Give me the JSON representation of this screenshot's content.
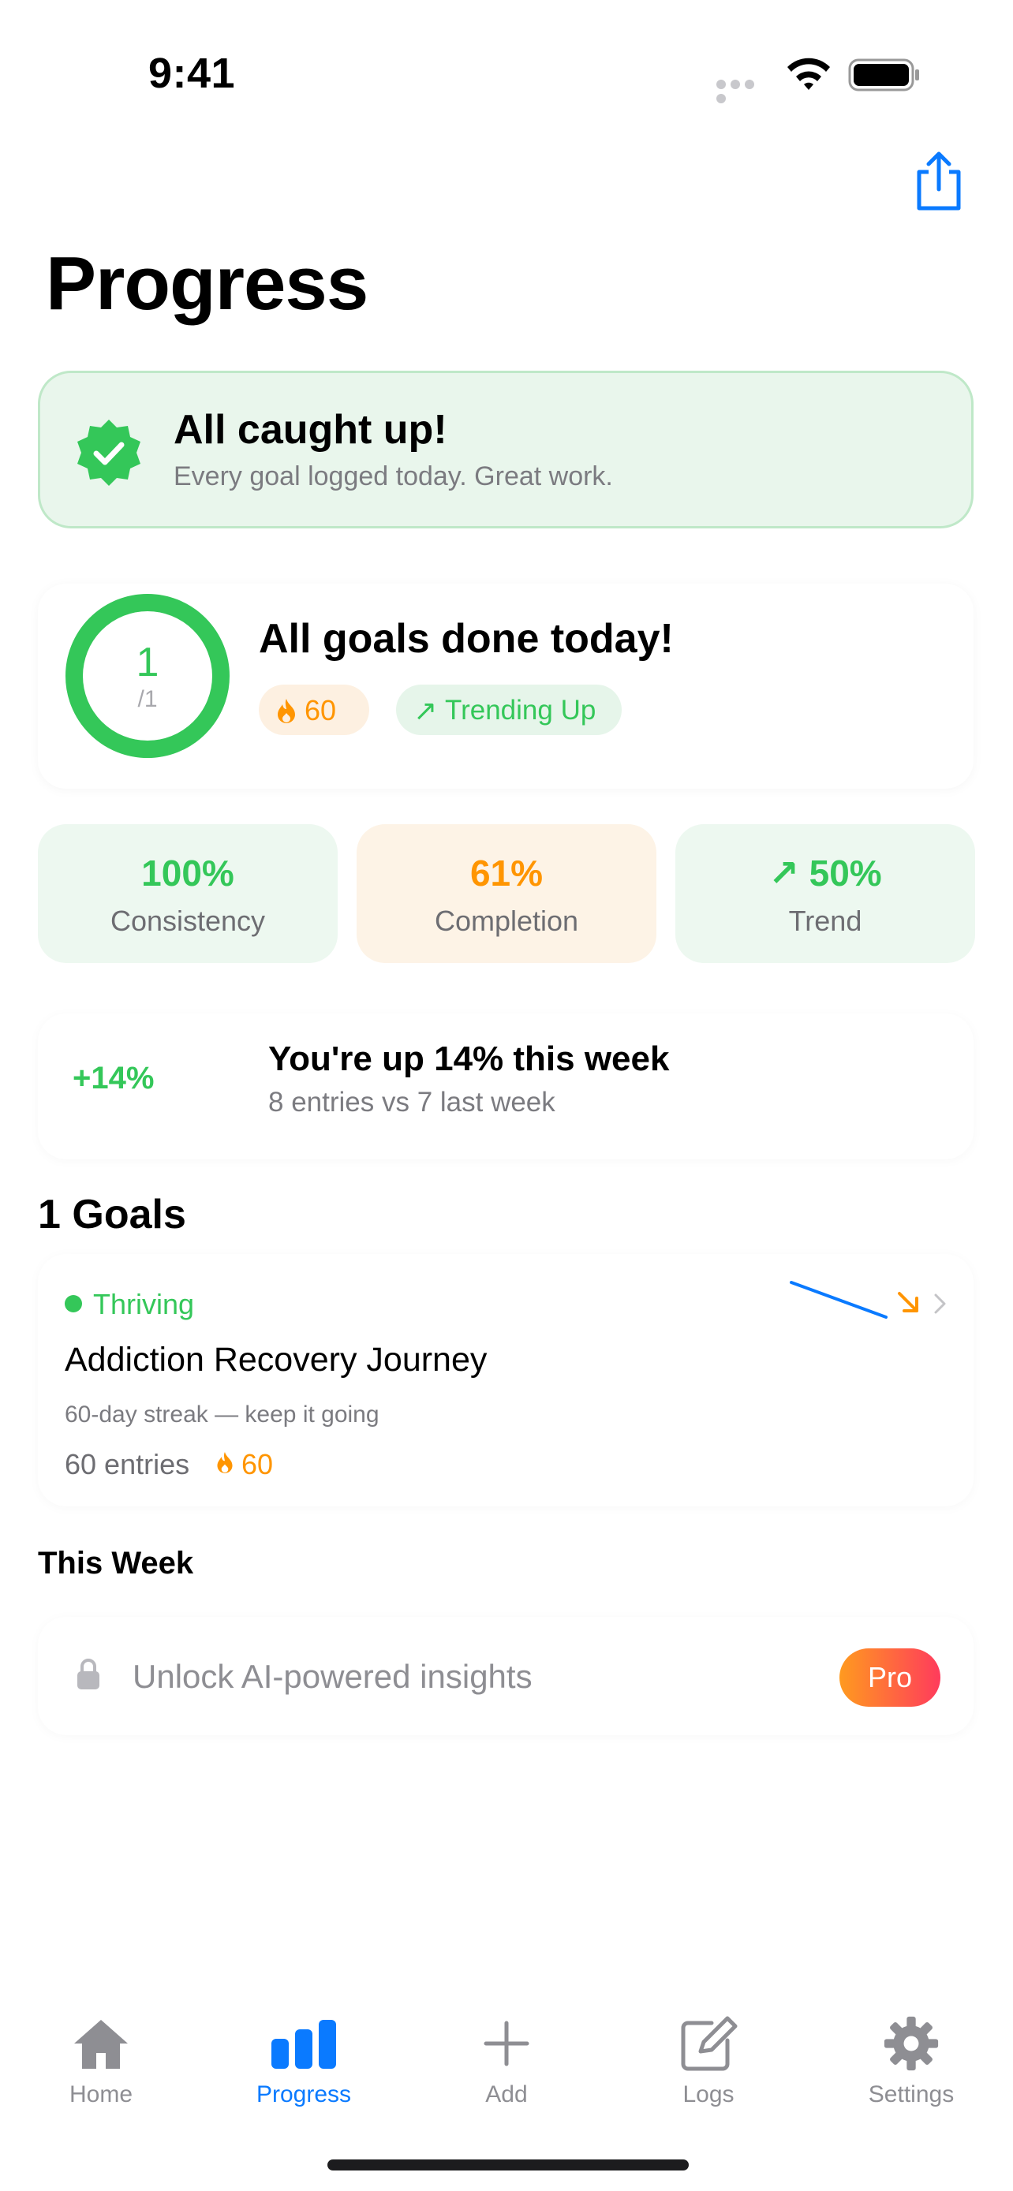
{
  "status_bar": {
    "time": "9:41"
  },
  "header": {
    "title": "Progress"
  },
  "banner": {
    "title": "All caught up!",
    "subtitle": "Every goal logged today. Great work."
  },
  "summary": {
    "ring_value": "1",
    "ring_total": "/1",
    "ring_fraction": 1.0,
    "title": "All goals done today!",
    "streak": "60",
    "trend_label": "Trending Up"
  },
  "stats": [
    {
      "value": "100%",
      "label": "Consistency"
    },
    {
      "value": "61%",
      "label": "Completion"
    },
    {
      "value": "50%",
      "label": "Trend"
    }
  ],
  "weekly": {
    "delta": "+14%",
    "title": "You're up 14% this week",
    "subtitle": "8 entries vs 7 last week"
  },
  "goals": {
    "header": "1 Goals",
    "items": [
      {
        "status": "Thriving",
        "title": "Addiction Recovery Journey",
        "note": "60-day streak — keep it going",
        "entries": "60 entries",
        "streak": "60"
      }
    ]
  },
  "this_week": {
    "header": "This Week",
    "unlock_text": "Unlock AI-powered insights",
    "badge": "Pro"
  },
  "tabs": [
    {
      "label": "Home",
      "icon": "house-icon"
    },
    {
      "label": "Progress",
      "icon": "bar-chart-icon",
      "active": true
    },
    {
      "label": "Add",
      "icon": "plus-icon"
    },
    {
      "label": "Logs",
      "icon": "pencil-square-icon"
    },
    {
      "label": "Settings",
      "icon": "gear-icon"
    }
  ],
  "colors": {
    "accent": "#0a7aff",
    "success": "#34c759",
    "streak": "#ff9500"
  }
}
